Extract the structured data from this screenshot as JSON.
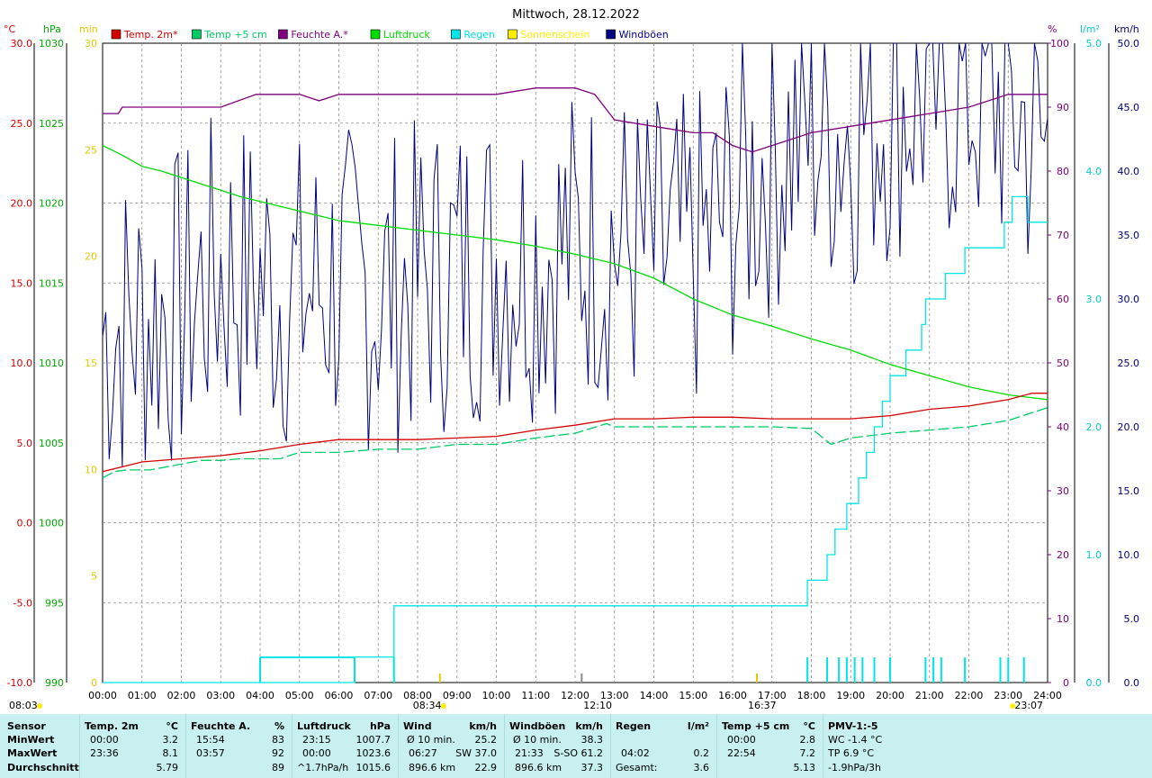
{
  "title": "Mittwoch, 28.12.2022",
  "colors": {
    "temp2m": "#d40000",
    "temp5cm": "#00cc66",
    "humidity": "#800080",
    "pressure": "#00dd00",
    "rain": "#00e5e5",
    "sun": "#ffee00",
    "gust": "#000080"
  },
  "left_axes": {
    "temp": {
      "unit": "°C",
      "ticks": [
        "30.0",
        "25.0",
        "20.0",
        "15.0",
        "10.0",
        "5.0",
        "0.0",
        "-5.0",
        "-10.0"
      ]
    },
    "pressure": {
      "unit": "hPa",
      "ticks": [
        "1030",
        "1025",
        "1020",
        "1015",
        "1010",
        "1005",
        "1000",
        "995",
        "990"
      ]
    },
    "sun_min": {
      "unit": "min",
      "ticks": [
        "30",
        "25",
        "20",
        "15",
        "10",
        "5",
        "0"
      ]
    }
  },
  "right_axes": {
    "humidity": {
      "unit": "%",
      "ticks": [
        "100",
        "90",
        "80",
        "70",
        "60",
        "50",
        "40",
        "30",
        "20",
        "10",
        "0"
      ]
    },
    "rain": {
      "unit": "l/m²",
      "ticks": [
        "5.0",
        "4.0",
        "3.0",
        "2.0",
        "1.0",
        "0.0"
      ]
    },
    "wind": {
      "unit": "km/h",
      "ticks": [
        "50.0",
        "45.0",
        "40.0",
        "35.0",
        "30.0",
        "25.0",
        "20.0",
        "15.0",
        "10.0",
        "5.0",
        "0.0"
      ]
    }
  },
  "legend": [
    {
      "label": "Temp. 2m*",
      "color": "#d40000"
    },
    {
      "label": "Temp +5 cm",
      "color": "#00cc66"
    },
    {
      "label": "Feuchte A.*",
      "color": "#800080"
    },
    {
      "label": "Luftdruck",
      "color": "#00dd00"
    },
    {
      "label": "Regen",
      "color": "#00e5e5"
    },
    {
      "label": "Sonnenschein",
      "color": "#ffee00"
    },
    {
      "label": "Windböen",
      "color": "#000080"
    }
  ],
  "x_ticks": [
    "00:00",
    "01:00",
    "02:00",
    "03:00",
    "04:00",
    "05:00",
    "06:00",
    "07:00",
    "08:00",
    "09:00",
    "10:00",
    "11:00",
    "12:00",
    "13:00",
    "14:00",
    "15:00",
    "16:00",
    "17:00",
    "18:00",
    "19:00",
    "20:00",
    "21:00",
    "22:00",
    "23:00",
    "24:00"
  ],
  "events": {
    "sunrise": "08:03",
    "sun_start": "08:34",
    "noon": "12:10",
    "sunset": "16:37",
    "moon": "23:07"
  },
  "chart_data": {
    "type": "line",
    "x_unit": "hours",
    "xlim": [
      0,
      24
    ],
    "series": [
      {
        "name": "Temp. 2m*",
        "axis": "temp",
        "ylim": [
          -10,
          30
        ],
        "x": [
          0,
          0.5,
          1,
          2,
          3,
          4,
          5,
          6,
          7,
          8,
          10,
          11,
          12,
          13,
          14,
          15,
          16,
          17,
          18,
          19,
          20,
          21,
          22,
          23,
          23.6,
          24
        ],
        "values": [
          3.2,
          3.5,
          3.8,
          4.0,
          4.2,
          4.5,
          4.9,
          5.2,
          5.2,
          5.2,
          5.4,
          5.8,
          6.1,
          6.5,
          6.5,
          6.6,
          6.6,
          6.5,
          6.5,
          6.5,
          6.7,
          7.1,
          7.3,
          7.7,
          8.1,
          8.1
        ]
      },
      {
        "name": "Temp +5 cm",
        "axis": "temp",
        "ylim": [
          -10,
          30
        ],
        "dashed": true,
        "x": [
          0,
          0.3,
          0.6,
          1.2,
          2.5,
          3,
          3.5,
          4,
          4.5,
          5,
          6,
          7,
          8,
          9,
          10,
          11,
          12,
          12.8,
          13,
          14,
          15,
          16,
          17,
          18,
          18.5,
          19,
          20,
          21,
          22,
          23,
          24
        ],
        "values": [
          2.8,
          3.2,
          3.3,
          3.3,
          3.9,
          3.9,
          4.0,
          4.0,
          4.0,
          4.4,
          4.4,
          4.6,
          4.6,
          4.9,
          4.9,
          5.3,
          5.6,
          6.2,
          6.0,
          6.0,
          6.0,
          6.0,
          6.0,
          5.9,
          4.9,
          5.3,
          5.6,
          5.8,
          6.0,
          6.4,
          7.2
        ]
      },
      {
        "name": "Feuchte A.*",
        "axis": "humidity",
        "ylim": [
          0,
          100
        ],
        "x": [
          0,
          0.4,
          0.5,
          2,
          2.4,
          3,
          3.9,
          4.5,
          5,
          5.5,
          6,
          7,
          8,
          9,
          10,
          11,
          12,
          12.5,
          13,
          14,
          15,
          15.5,
          16,
          16.5,
          17,
          18,
          19,
          20,
          21,
          22,
          23,
          24
        ],
        "values": [
          89,
          89,
          90,
          90,
          90,
          90,
          92,
          92,
          92,
          91,
          92,
          92,
          92,
          92,
          92,
          93,
          93,
          92,
          88,
          87,
          86,
          86,
          84,
          83,
          84,
          86,
          87,
          88,
          89,
          90,
          92,
          92
        ]
      },
      {
        "name": "Luftdruck",
        "axis": "pressure",
        "ylim": [
          990,
          1030
        ],
        "x": [
          0,
          0.5,
          1,
          1.5,
          2,
          2.5,
          3,
          3.5,
          4,
          5,
          6,
          7,
          8,
          9,
          10,
          11,
          12,
          13,
          14,
          15,
          16,
          17,
          18,
          19,
          20,
          21,
          22,
          23,
          24
        ],
        "values": [
          1023.6,
          1023.0,
          1022.3,
          1022.0,
          1021.6,
          1021.2,
          1020.8,
          1020.4,
          1020.1,
          1019.5,
          1018.9,
          1018.6,
          1018.3,
          1018.0,
          1017.7,
          1017.3,
          1016.8,
          1016.2,
          1015.3,
          1014.0,
          1013.0,
          1012.3,
          1011.5,
          1010.8,
          1009.9,
          1009.2,
          1008.5,
          1008.0,
          1007.7
        ]
      },
      {
        "name": "Regen",
        "axis": "rain",
        "ylim": [
          0,
          5
        ],
        "step": true,
        "x": [
          0,
          6.4,
          6.4,
          7.4,
          7.4,
          17.9,
          17.9,
          18.4,
          18.6,
          18.9,
          19.2,
          19.4,
          19.6,
          19.8,
          20.0,
          20.4,
          20.8,
          20.9,
          21.4,
          21.9,
          22.9,
          23.1,
          23.5,
          24
        ],
        "values": [
          0.0,
          0.0,
          0.2,
          0.2,
          0.6,
          0.6,
          0.8,
          1.0,
          1.2,
          1.4,
          1.6,
          1.8,
          2.0,
          2.2,
          2.4,
          2.6,
          2.8,
          3.0,
          3.2,
          3.4,
          3.6,
          3.8,
          3.6,
          3.6
        ]
      },
      {
        "name": "Windböen",
        "axis": "wind",
        "ylim": [
          0,
          50
        ],
        "noisy": true,
        "x": [
          0,
          1,
          2,
          3,
          4,
          5,
          6,
          7,
          8,
          9,
          10,
          11,
          12,
          13,
          14,
          15,
          16,
          17,
          18,
          19,
          20,
          21,
          22,
          23,
          24
        ],
        "values": [
          26,
          27,
          28,
          31,
          30,
          29,
          30,
          29,
          30,
          31,
          32,
          32,
          33,
          33,
          32,
          32,
          36,
          40,
          42,
          42,
          44,
          45,
          45,
          44,
          40
        ]
      }
    ]
  },
  "stats": {
    "rows": [
      "Sensor",
      "MinWert",
      "MaxWert",
      "Durchschnitt"
    ],
    "temp2m": {
      "head": "Temp. 2m",
      "unit": "°C",
      "min_time": "00:00",
      "min": "3.2",
      "max_time": "23:36",
      "max": "8.1",
      "avg": "5.79"
    },
    "humidity": {
      "head": "Feuchte A.",
      "unit": "%",
      "min_time": "15:54",
      "min": "83",
      "max_time": "03:57",
      "max": "92",
      "avg": "89"
    },
    "pressure": {
      "head": "Luftdruck",
      "unit": "hPa",
      "min_time": "23:15",
      "min": "1007.7",
      "max_time": "00:00",
      "max": "1023.6",
      "avg_label": "^1.7hPa/h",
      "avg": "1015.6"
    },
    "wind": {
      "head": "Wind",
      "unit": "km/h",
      "r1_label": "Ø 10 min.",
      "r1": "25.2",
      "r2_time": "06:27",
      "r2_dir": "SW 37.0",
      "r3_label": "896.6 km",
      "r3": "22.9"
    },
    "gust": {
      "head": "Windböen",
      "unit": "km/h",
      "r1_label": "Ø 10 min.",
      "r1": "38.3",
      "r2_time": "21:33",
      "r2_dir": "S-SO 61.2",
      "r3_label": "896.6 km",
      "r3": "37.3"
    },
    "rain": {
      "head": "Regen",
      "unit": "l/m²",
      "r2_time": "04:02",
      "r2": "0.2",
      "r3_label": "Gesamt:",
      "r3": "3.6"
    },
    "temp5cm": {
      "head": "Temp +5 cm",
      "unit": "°C",
      "min_time": "00:00",
      "min": "2.8",
      "max_time": "22:54",
      "max": "7.2",
      "avg": "5.13"
    },
    "pmv": {
      "head": "PMV-1:-5",
      "r1": "WC -1.4 °C",
      "r2": "TP 6.9 °C",
      "r3": "-1.9hPa/3h"
    }
  }
}
